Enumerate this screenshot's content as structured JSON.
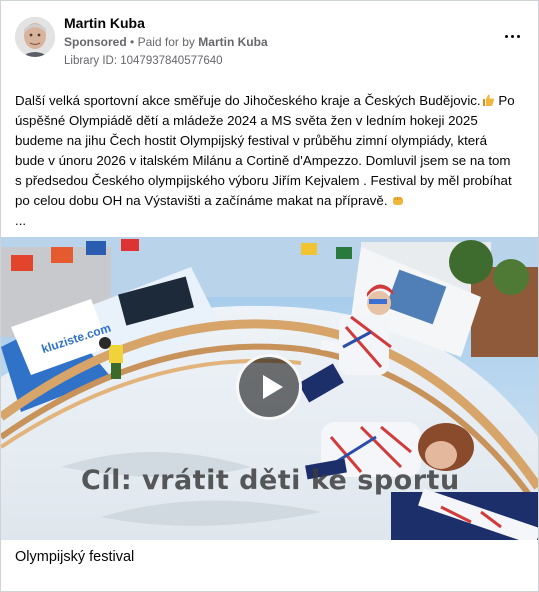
{
  "post": {
    "author": "Martin Kuba",
    "sponsored_label": "Sponsored",
    "separator": "•",
    "paid_for_label": "Paid for by",
    "paid_by": "Martin Kuba",
    "library_id": "Library ID: 1047937840577640",
    "body_text": "Další velká sportovní akce směřuje do Jihočeského kraje a Českých Budějovic.",
    "body_text_rest": " Po úspěšné Olympiádě dětí a mládeže 2024 a MS světa žen v ledním hokeji 2025 budeme na jihu Čech hostit Olympijský festival v průběhu zimní olympiády, která bude v únoru 2026 v italském Milánu a Cortině d'Ampezzo. Domluvil jsem se na tom s předsedou Českého olympijského výboru Jiřím Kejvalem . Festival by měl probíhat po celou dobu OH na Výstavišti a začínáme makat na přípravě. ",
    "ellipsis": "...",
    "video_overlay_text": "Cíl: vrátit děti ke sportu",
    "sign_text": "kluziste.com",
    "caption": "Olympijský festival"
  },
  "icons": {
    "more": "more-horizontal-icon",
    "play": "play-icon",
    "thumbs": "thumbs-up-emoji",
    "fist": "fist-bump-emoji"
  },
  "colors": {
    "meta_gray": "#65676b",
    "text": "#050505",
    "border": "#cfd3d8"
  }
}
